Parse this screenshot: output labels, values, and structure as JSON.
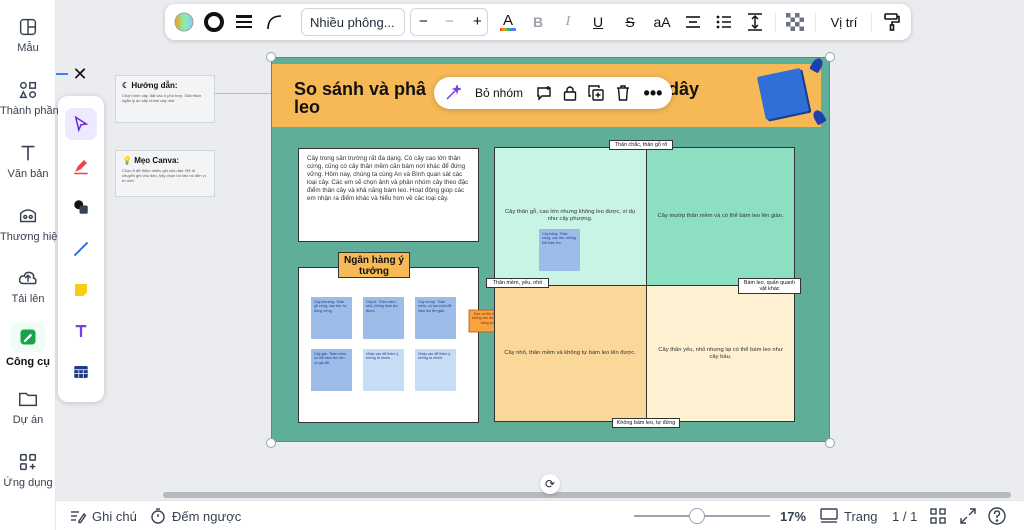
{
  "rail": {
    "items": [
      {
        "label": "Mẫu",
        "icon": "template-icon"
      },
      {
        "label": "Thành phần",
        "icon": "elements-icon"
      },
      {
        "label": "Văn bản",
        "icon": "text-icon"
      },
      {
        "label": "Thương hiệu",
        "icon": "brand-icon"
      },
      {
        "label": "Tải lên",
        "icon": "upload-icon"
      },
      {
        "label": "Công cụ",
        "icon": "tools-icon"
      },
      {
        "label": "Dự án",
        "icon": "folder-icon"
      },
      {
        "label": "Ứng dụng",
        "icon": "apps-icon"
      }
    ],
    "active": "Công cụ"
  },
  "toolbar": {
    "font": "Nhiều phông...",
    "size_minus": "−",
    "size_value": "−",
    "size_plus": "+",
    "color_letter": "A",
    "bold": "B",
    "italic": "I",
    "underline": "U",
    "strike": "S",
    "case": "aA",
    "position": "Vị trí"
  },
  "context_toolbar": {
    "ungroup": "Bỏ nhóm"
  },
  "comments": [
    {
      "title": "Hướng dẫn:",
      "body": "Chọn hình cây, đặt vào ô phù hợp. Giải thích ngắn lý do sắp nhóm cây nhé."
    },
    {
      "title": "Mẹo Canva:",
      "body": "Chọn 5 để thêm nhiều ghi chú dán. Để di chuyển ghi chú dán, hãy chọn rồi kéo nó đến vị trí mới."
    }
  ],
  "board": {
    "title": "So sánh và phân nhóm cây thân gỗ và cây thân leo",
    "title_visible_start": "So sánh và phâ",
    "title_visible_end": "dây",
    "title_line2": "leo",
    "intro": "Cây trong sân trường rất đa dạng. Có cây cao lớn thân cứng, cũng có cây thân mềm cần bám nơi khác để đứng vững. Hôm nay, chúng ta cùng An và Bình quan sát các loại cây. Các em sẽ chọn ảnh và phân nhóm cây theo đặc điểm thân cây và khả năng bám leo. Hoạt động giúp các em nhận ra điểm khác và hiểu hơn về các loại cây.",
    "bank_title": "Ngân hàng ý tưởng",
    "notes": [
      "Cây phượng: Thân gỗ cứng, cao lớn, tự đứng vững.",
      "Cây bí: Thân mềm, nhỏ, không bám leo được.",
      "Cây mướp: Thân mềm, có tua cuốn để bám leo lên giàn.",
      "Cây gấc: Thân mềm, có thể bám leo nếu có giá đỡ.",
      "Nhấp vào để thêm ý tưởng từ nhóm.",
      "Nhấp vào để thêm ý tưởng từ nhóm."
    ],
    "arrow_text": "Kéo và thả để sắp xếp ý tưởng vào đúng vị trí trong bảng phân loại.",
    "quadrants": {
      "top_left": "Cây thân gỗ, cao lớn nhưng không leo được, ví dụ như cây phượng.",
      "top_left_note": "Cây bàng: Thân cứng, cao lớn, không thể bám leo.",
      "top_right": "Cây mướp thân mềm và có thể bám leo lên giàn.",
      "bottom_left": "Cây nhỏ, thân mềm và không tự bám leo lên được.",
      "bottom_right": "Cây thân yếu, nhỏ nhưng lại có thể bám leo như cây bầu."
    },
    "axes": {
      "top": "Thân chắc, thân gỗ rõ",
      "left": "Thân mềm, yếu, nhỏ",
      "right": "Bám leo, quấn quanh vật khác",
      "bottom": "Không bám leo, tự đứng"
    }
  },
  "bottom_bar": {
    "notes": "Ghi chú",
    "timer": "Đếm ngược",
    "zoom": "17%",
    "pages": "Trang",
    "page_count": "1 / 1",
    "zoom_fraction": 0.17
  }
}
